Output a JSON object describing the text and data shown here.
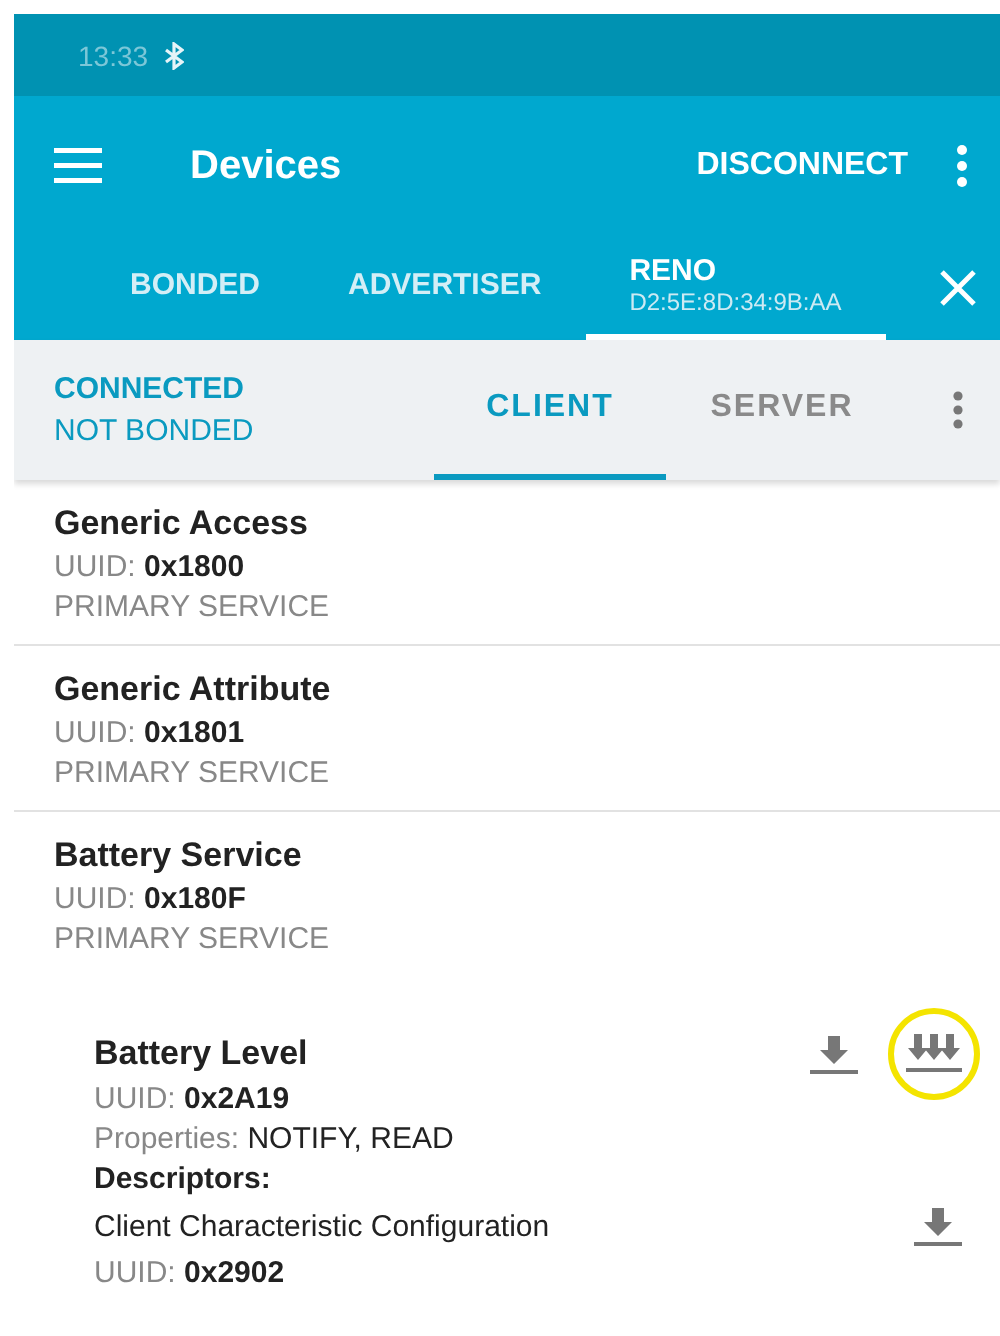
{
  "status_bar": {
    "time": "13:33"
  },
  "app_bar": {
    "title": "Devices",
    "action": "DISCONNECT"
  },
  "device_tabs": [
    {
      "label": "BONDED",
      "selected": false
    },
    {
      "label": "ADVERTISER",
      "selected": false
    },
    {
      "label": "RENO",
      "subtitle": "D2:5E:8D:34:9B:AA",
      "selected": true
    }
  ],
  "connection": {
    "state": "CONNECTED",
    "bond": "NOT BONDED"
  },
  "sub_tabs": [
    {
      "label": "CLIENT",
      "selected": true
    },
    {
      "label": "SERVER",
      "selected": false
    }
  ],
  "services": [
    {
      "name": "Generic Access",
      "uuid_label": "UUID:",
      "uuid": "0x1800",
      "type": "PRIMARY SERVICE"
    },
    {
      "name": "Generic Attribute",
      "uuid_label": "UUID:",
      "uuid": "0x1801",
      "type": "PRIMARY SERVICE"
    },
    {
      "name": "Battery Service",
      "uuid_label": "UUID:",
      "uuid": "0x180F",
      "type": "PRIMARY SERVICE",
      "characteristics": [
        {
          "name": "Battery Level",
          "uuid_label": "UUID:",
          "uuid": "0x2A19",
          "properties_label": "Properties:",
          "properties": "NOTIFY, READ",
          "highlighted": true,
          "descriptors_label": "Descriptors:",
          "descriptors": [
            {
              "name": "Client Characteristic Configuration",
              "uuid_label": "UUID:",
              "uuid": "0x2902"
            }
          ]
        }
      ]
    }
  ]
}
